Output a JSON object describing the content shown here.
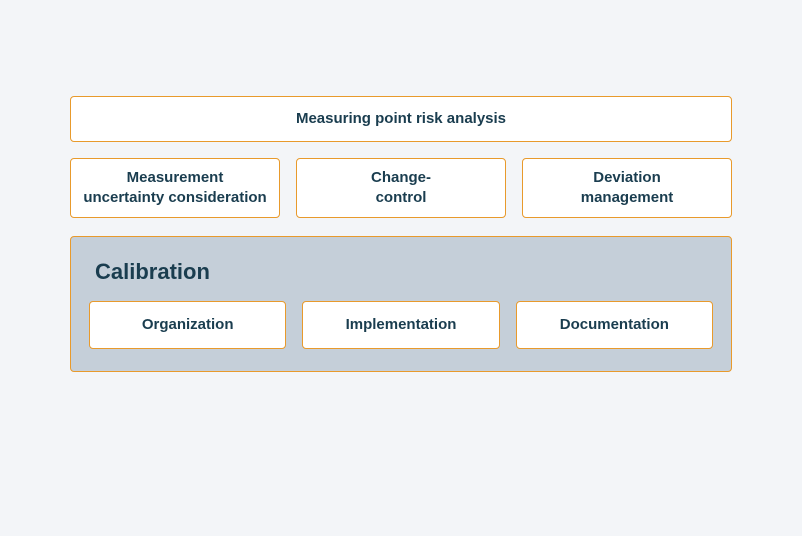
{
  "top": {
    "label": "Measuring point risk analysis"
  },
  "midRow": [
    {
      "label_line1": "Measurement",
      "label_line2": "uncertainty consideration"
    },
    {
      "label_line1": "Change-",
      "label_line2": "control"
    },
    {
      "label_line1": "Deviation",
      "label_line2": "management"
    }
  ],
  "calibration": {
    "title": "Calibration",
    "items": [
      {
        "label": "Organization"
      },
      {
        "label": "Implementation"
      },
      {
        "label": "Documentation"
      }
    ]
  }
}
